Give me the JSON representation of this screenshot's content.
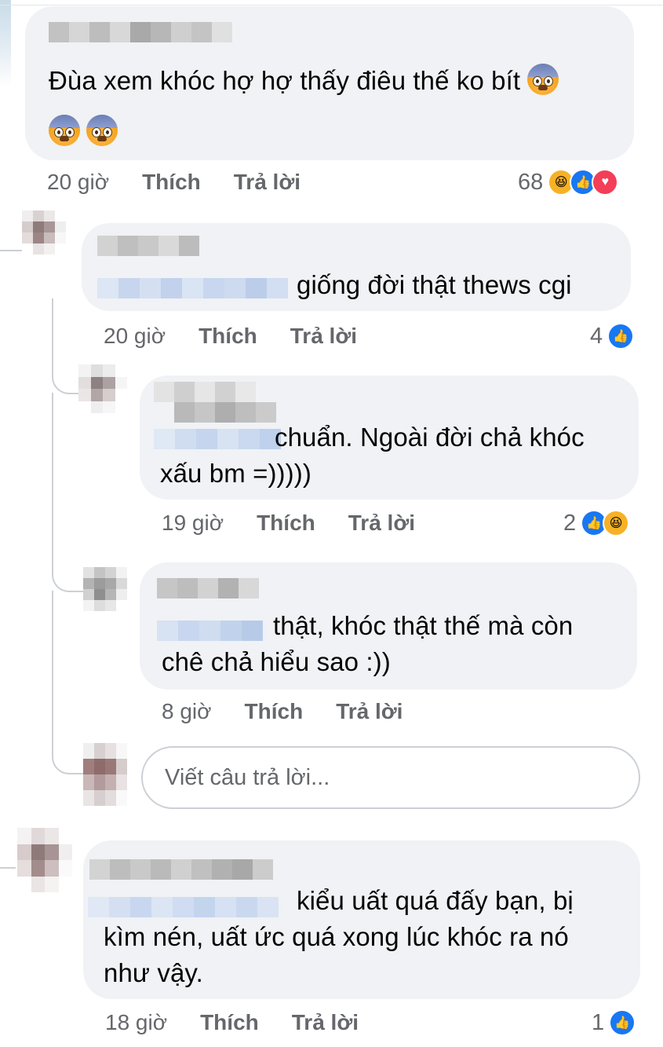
{
  "comments": [
    {
      "text_line1": "Đùa xem khóc hợ hợ thấy điêu thế ko bít",
      "emoji_name": "anxious-face-with-sweat",
      "time": "20 giờ",
      "like_label": "Thích",
      "reply_label": "Trả lời",
      "reaction_count": "68",
      "reactions": [
        "haha",
        "like",
        "love"
      ]
    },
    {
      "text": "giống đời thật thews cgi",
      "time": "20 giờ",
      "like_label": "Thích",
      "reply_label": "Trả lời",
      "reaction_count": "4",
      "reactions": [
        "like"
      ]
    },
    {
      "text_line1": "chuẩn. Ngoài đời chả khóc",
      "text_line2": "xấu bm =)))))",
      "time": "19 giờ",
      "like_label": "Thích",
      "reply_label": "Trả lời",
      "reaction_count": "2",
      "reactions": [
        "like",
        "haha"
      ]
    },
    {
      "text_line1": "thật, khóc thật thế mà còn",
      "text_line2": "chê chả hiểu sao :))",
      "time": "8 giờ",
      "like_label": "Thích",
      "reply_label": "Trả lời"
    },
    {
      "text_line1": "kiểu uất quá đấy bạn, bị",
      "text_line2": "kìm nén, uất ức quá xong lúc khóc ra nó",
      "text_line3": "như vậy.",
      "time": "18 giờ",
      "like_label": "Thích",
      "reply_label": "Trả lời",
      "reaction_count": "1",
      "reactions": [
        "like"
      ]
    }
  ],
  "reply_box": {
    "placeholder": "Viết câu trả lời..."
  },
  "colors": {
    "bubble": "#f0f2f5",
    "meta_text": "#65676b",
    "like_blue": "#1877f2",
    "love_red": "#f33e58",
    "haha_yellow": "#f7b125"
  }
}
